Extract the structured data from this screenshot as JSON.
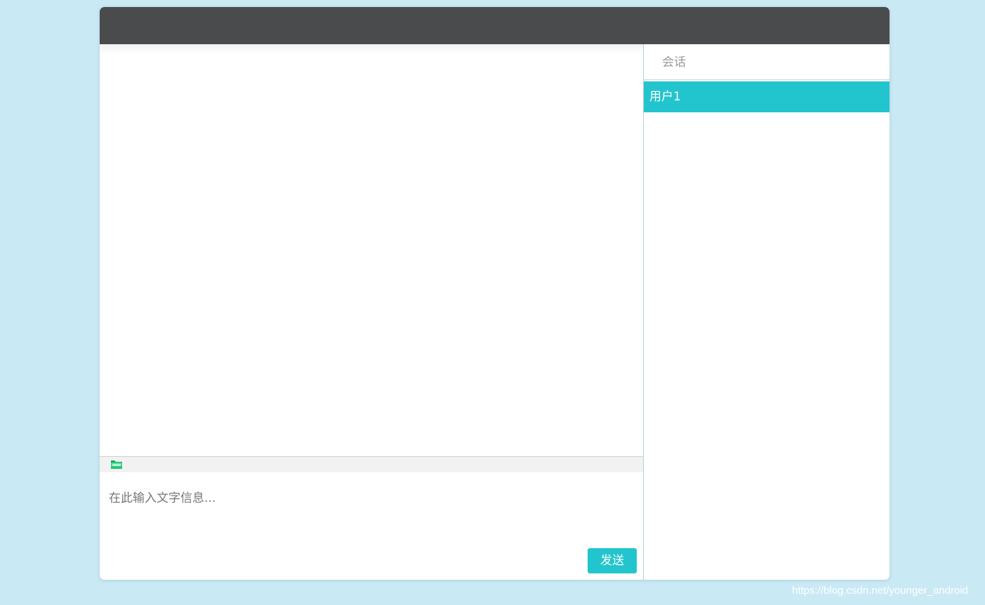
{
  "chat": {
    "input_placeholder": "在此输入文字信息...",
    "input_value": "",
    "send_label": "发送",
    "toolbar": {
      "file_icon": "folder-icon"
    }
  },
  "sessions": {
    "header_label": "会话",
    "items": [
      {
        "label": "用户1",
        "active": true
      }
    ]
  },
  "watermark": "https://blog.csdn.net/younger_android",
  "colors": {
    "accent": "#22c5ce",
    "titlebar": "#4a4b4d",
    "background": "#c9e9f5"
  }
}
